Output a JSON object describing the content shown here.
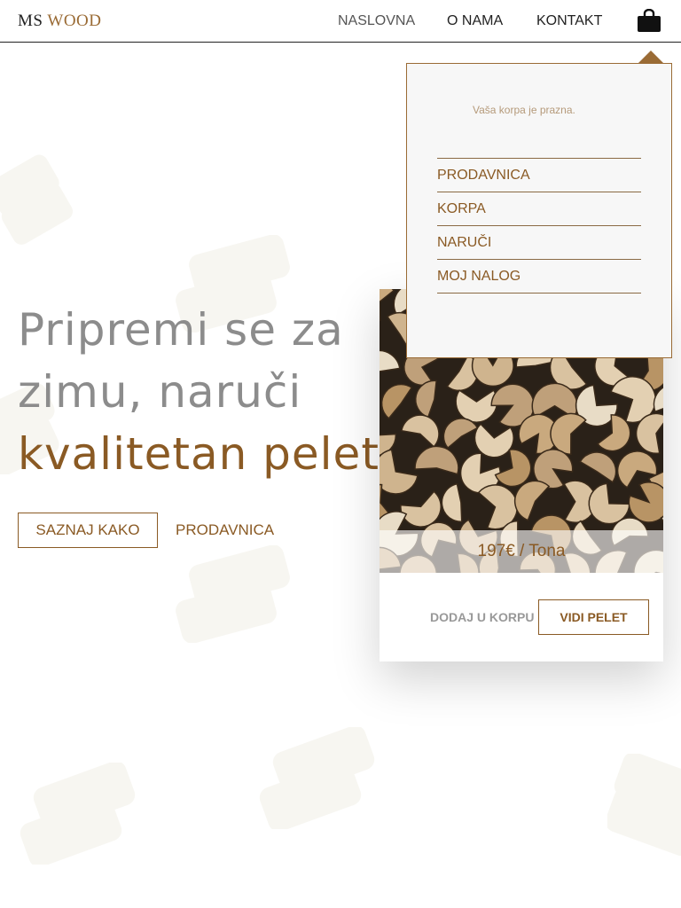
{
  "header": {
    "logo_ms": "MS",
    "logo_wood": "WOOD",
    "nav": [
      "NASLOVNA",
      "O NAMA",
      "KONTAKT"
    ],
    "cart_icon": "shopping-bag-icon"
  },
  "hero": {
    "line1": "Pripremi se za",
    "line2": "zimu, naruči",
    "line3": "kvalitetan pelet!",
    "button_learn": "SAZNAJ KAKO",
    "link_shop": "PRODAVNICA"
  },
  "product": {
    "price": "197€ / Tona",
    "add_to_cart": "DODAJ U KORPU",
    "view": "VIDI PELET"
  },
  "cart_dropdown": {
    "empty_message": "Vaša korpa je prazna.",
    "menu": [
      "PRODAVNICA",
      "KORPA",
      "NARUČI",
      "MOJ NALOG"
    ]
  },
  "colors": {
    "brand_brown": "#8a5a24",
    "logo_wood": "#9a6b35",
    "hero_gray": "#8c8c8c",
    "log_decoration": "#f7f6f1"
  }
}
